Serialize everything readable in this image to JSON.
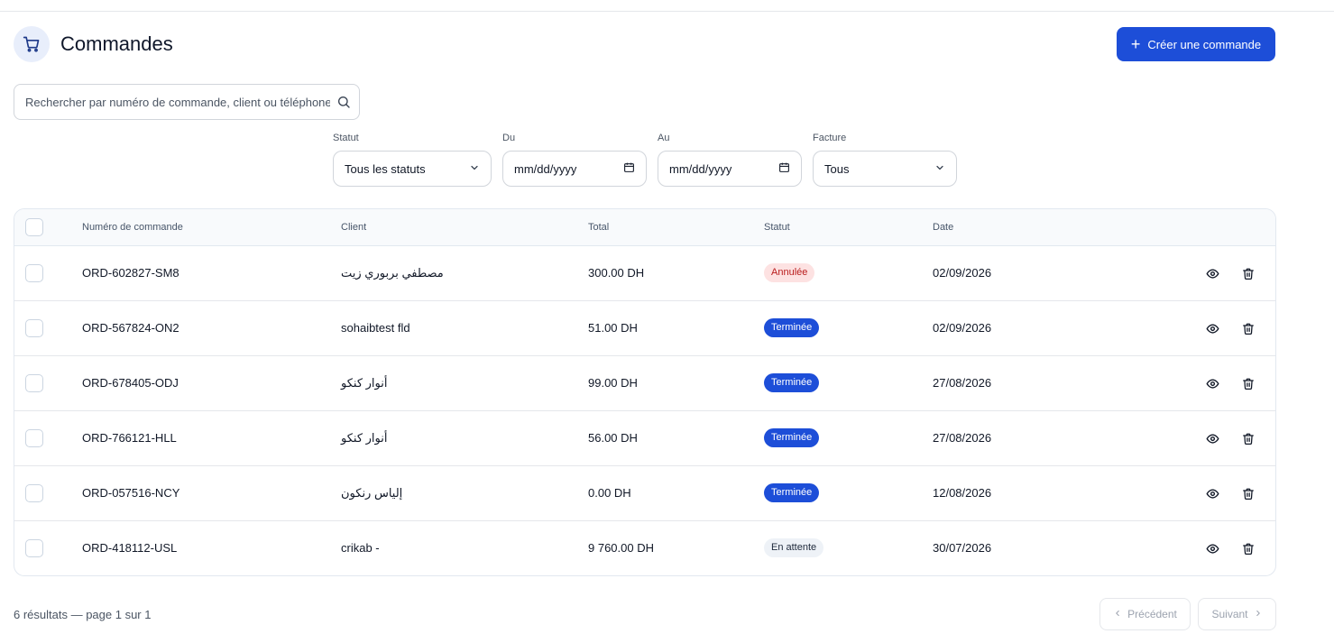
{
  "header": {
    "icon": "cart-icon",
    "title": "Commandes",
    "create_label": "Créer une commande"
  },
  "search": {
    "placeholder": "Rechercher par numéro de commande, client ou téléphone",
    "value": ""
  },
  "filters": {
    "status": {
      "label": "Statut",
      "value": "Tous les statuts"
    },
    "from": {
      "label": "Du",
      "value": "mm/dd/yyyy"
    },
    "to": {
      "label": "Au",
      "value": "mm/dd/yyyy"
    },
    "invoice": {
      "label": "Facture",
      "value": "Tous"
    }
  },
  "table": {
    "columns": [
      "Numéro de commande",
      "Client",
      "Total",
      "Statut",
      "Date"
    ],
    "rows": [
      {
        "number": "ORD-602827-SM8",
        "client": "مصطفي بربوري زيت",
        "total": "300.00 DH",
        "status": "Annulée",
        "status_kind": "cancel",
        "date": "02/09/2026"
      },
      {
        "number": "ORD-567824-ON2",
        "client": "sohaibtest fld",
        "total": "51.00 DH",
        "status": "Terminée",
        "status_kind": "done",
        "date": "02/09/2026"
      },
      {
        "number": "ORD-678405-ODJ",
        "client": "أنوار كنكو",
        "total": "99.00 DH",
        "status": "Terminée",
        "status_kind": "done",
        "date": "27/08/2026"
      },
      {
        "number": "ORD-766121-HLL",
        "client": "أنوار كنكو",
        "total": "56.00 DH",
        "status": "Terminée",
        "status_kind": "done",
        "date": "27/08/2026"
      },
      {
        "number": "ORD-057516-NCY",
        "client": "إلياس رنكون",
        "total": "0.00 DH",
        "status": "Terminée",
        "status_kind": "done",
        "date": "12/08/2026"
      },
      {
        "number": "ORD-418112-USL",
        "client": "crikab -",
        "total": "9 760.00 DH",
        "status": "En attente",
        "status_kind": "pending",
        "date": "30/07/2026"
      }
    ]
  },
  "pagination": {
    "summary": "6 résultats — page 1 sur 1",
    "prev_label": "Précédent",
    "next_label": "Suivant"
  },
  "colors": {
    "accent": "#1d4ed8",
    "cancel_bg": "#fde2e2",
    "cancel_text": "#b91c1c",
    "pending_bg": "#eef2f7"
  }
}
